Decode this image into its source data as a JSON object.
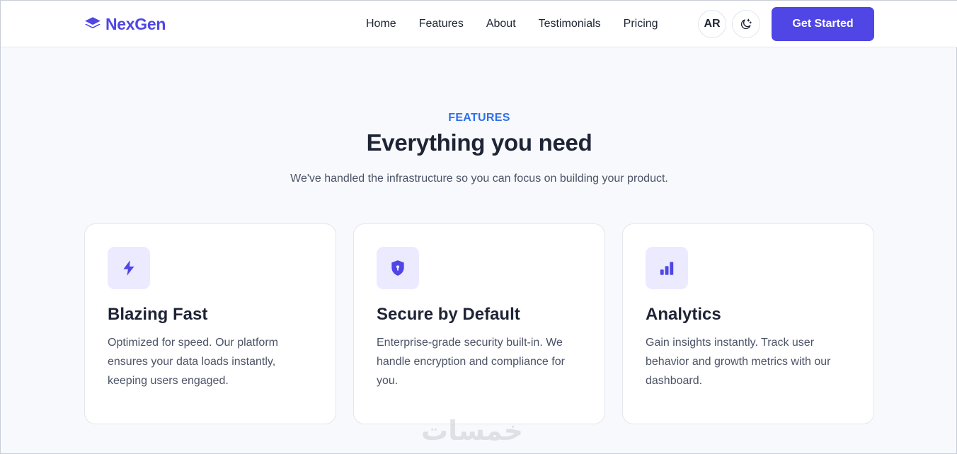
{
  "brand": {
    "name": "NexGen",
    "color": "#4f46e5",
    "icon": "layers-icon"
  },
  "nav": {
    "items": [
      "Home",
      "Features",
      "About",
      "Testimonials",
      "Pricing"
    ],
    "lang_label": "AR",
    "theme_icon": "moon-stars-icon",
    "cta_label": "Get Started"
  },
  "section": {
    "eyebrow": "FEATURES",
    "title": "Everything you need",
    "subtitle": "We've handled the infrastructure so you can focus on building your product."
  },
  "cards": [
    {
      "icon": "lightning-bolt-icon",
      "title": "Blazing Fast",
      "description": "Optimized for speed. Our platform ensures your data loads instantly, keeping users engaged."
    },
    {
      "icon": "shield-lock-icon",
      "title": "Secure by Default",
      "description": "Enterprise-grade security built-in. We handle encryption and compliance for you."
    },
    {
      "icon": "bar-chart-icon",
      "title": "Analytics",
      "description": "Gain insights instantly. Track user behavior and growth metrics with our dashboard."
    }
  ],
  "watermark": "خمسات",
  "colors": {
    "accent": "#4f46e5",
    "eyebrow": "#2f6fea",
    "icon_tile": "#ebeaff",
    "page_bg": "#f8f9fc"
  }
}
